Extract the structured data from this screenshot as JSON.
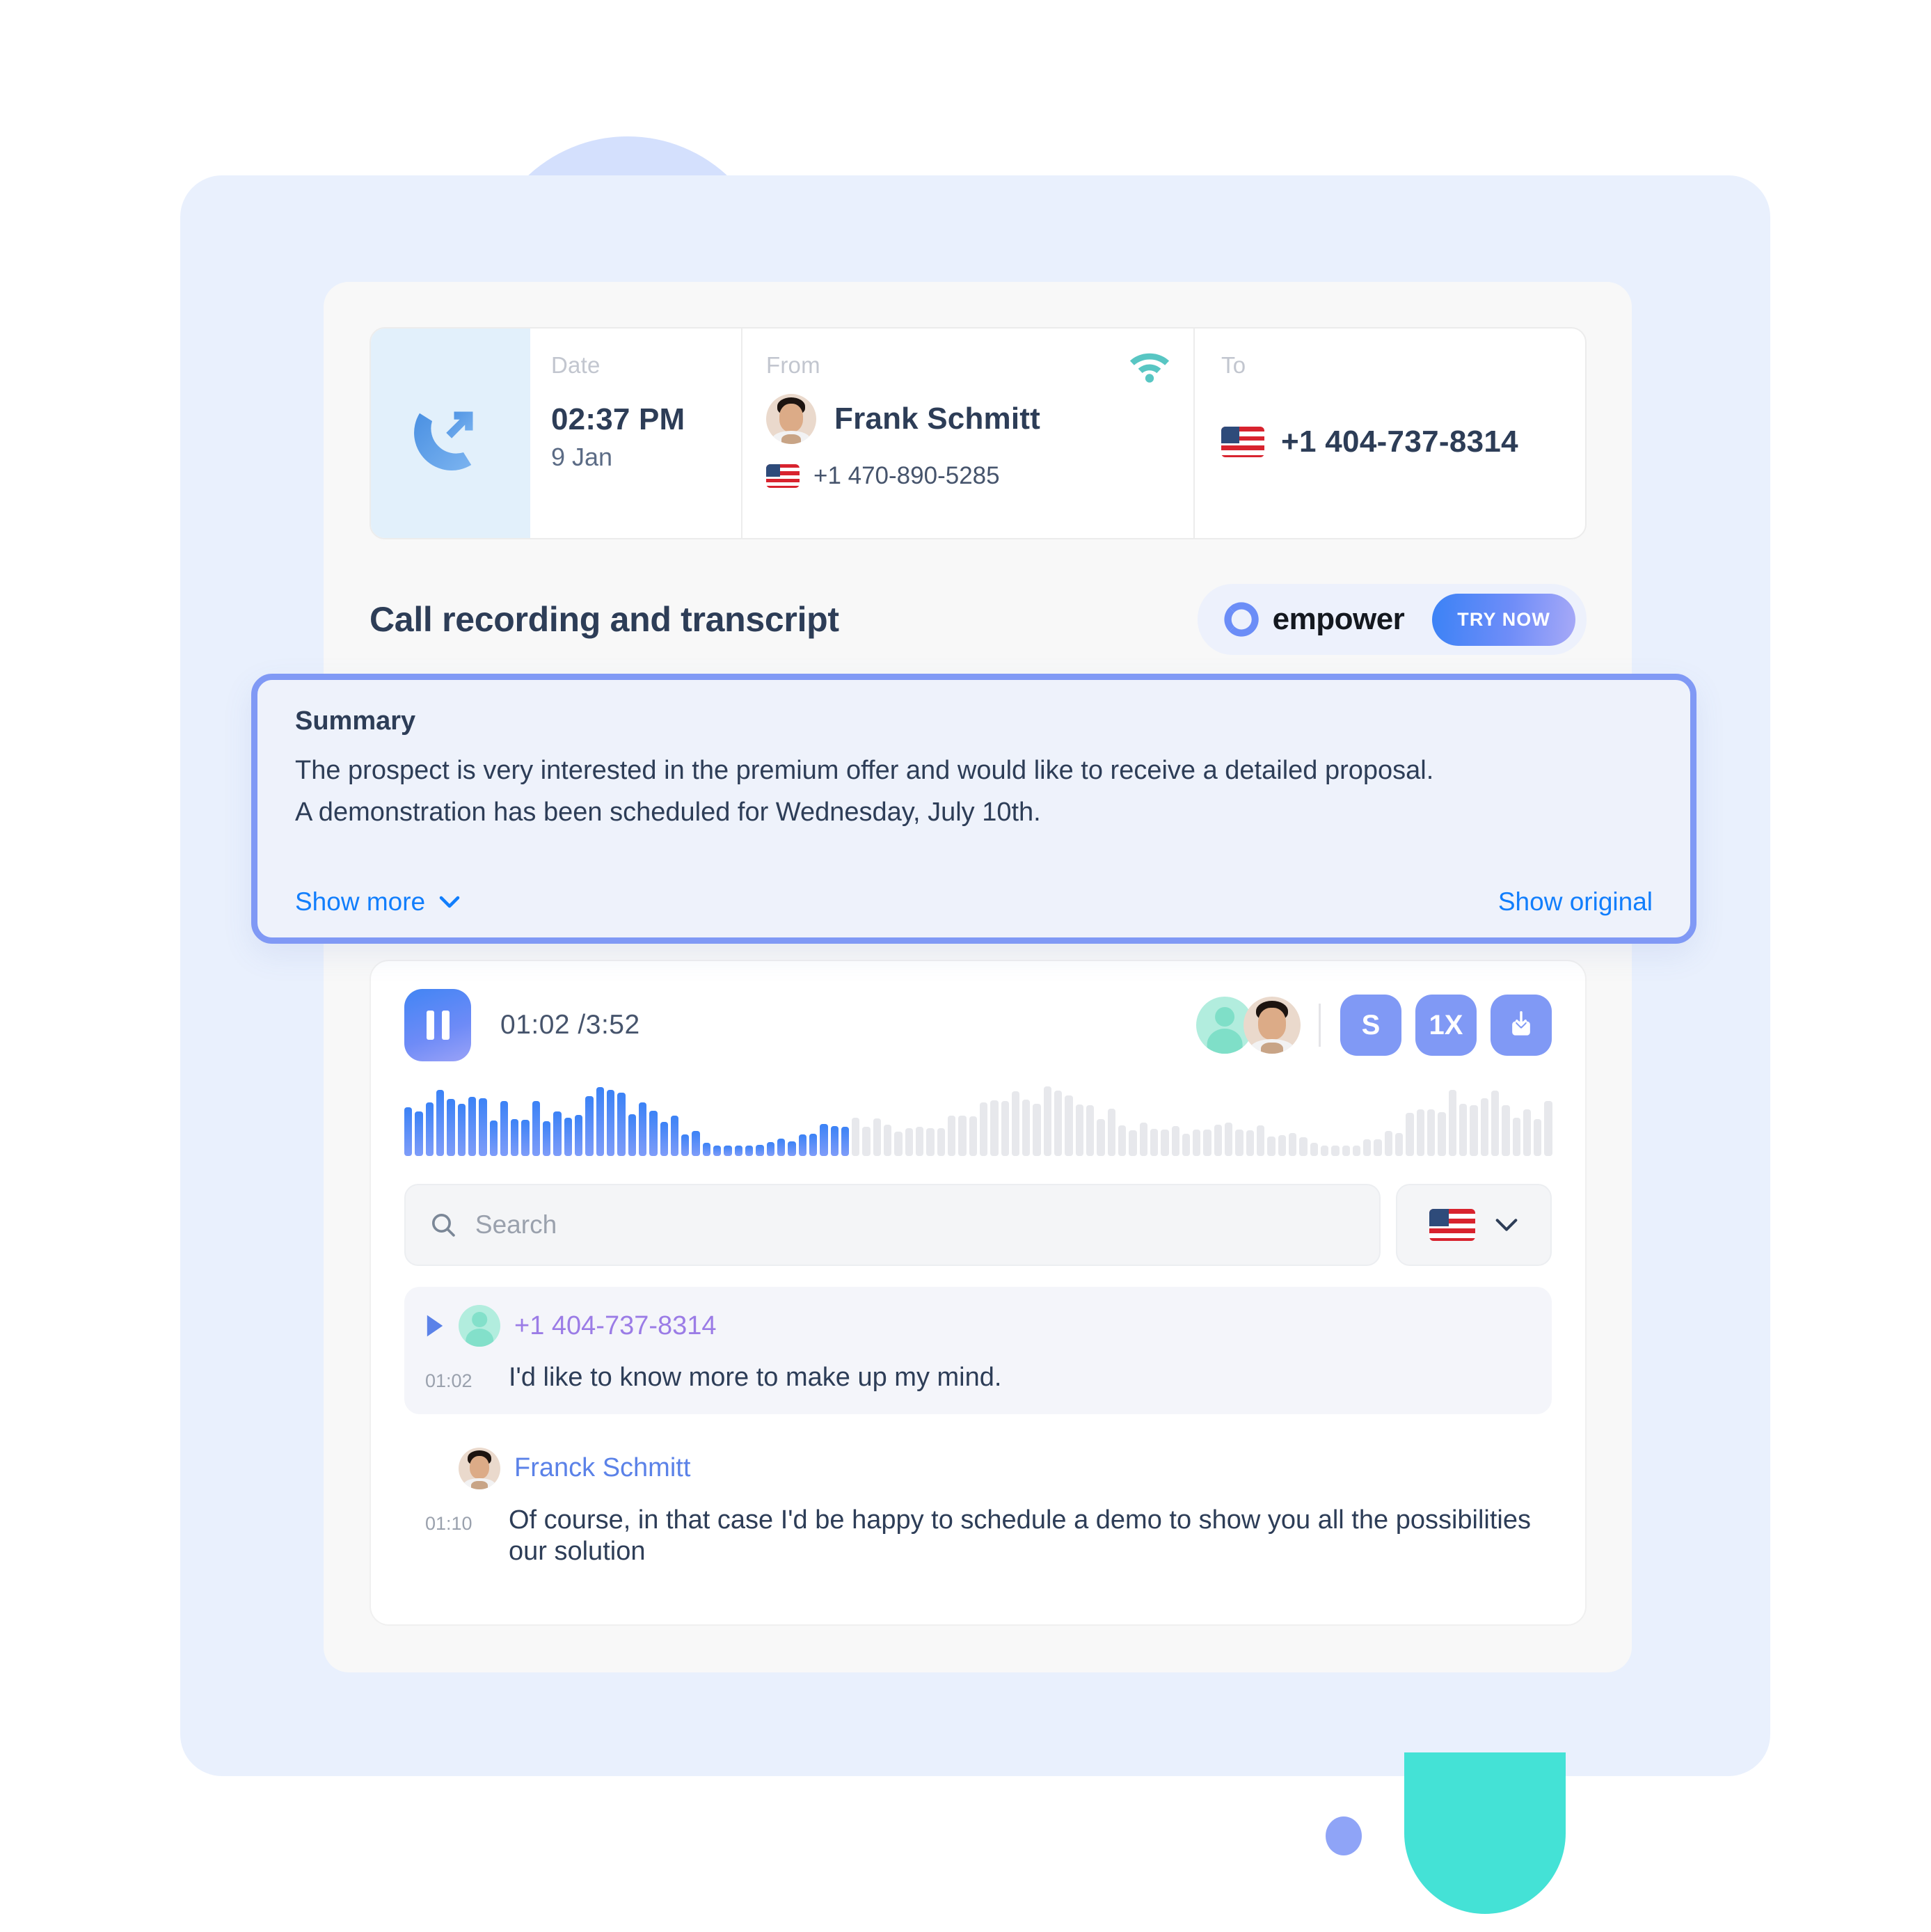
{
  "call_header": {
    "call_icon": "outgoing-call-icon",
    "date": {
      "label": "Date",
      "time": "02:37 PM",
      "day": "9 Jan"
    },
    "from": {
      "label": "From",
      "name": "Frank Schmitt",
      "phone": "+1 470-890-5285",
      "flag": "us-flag-icon",
      "signal_icon": "wifi-icon"
    },
    "to": {
      "label": "To",
      "phone": "+1 404-737-8314",
      "flag": "us-flag-icon"
    }
  },
  "section": {
    "title": "Call recording and transcript",
    "badge": {
      "logo": "empower-logo-icon",
      "name": "empower",
      "cta": "TRY NOW"
    }
  },
  "summary": {
    "heading": "Summary",
    "paragraph1": "The prospect is very interested in the premium offer and would like to receive a detailed proposal.",
    "paragraph2": "A demonstration has been scheduled for Wednesday, July 10th.",
    "show_more": "Show more",
    "show_original": "Show original"
  },
  "player": {
    "state": "playing",
    "current_time": "01:02",
    "total_time": "3:52",
    "timecode": "01:02 /3:52",
    "progress_percent": 27,
    "controls": {
      "subtitles_label": "S",
      "speed_label": "1X",
      "download_icon": "download-icon"
    },
    "speakers": [
      "generic-avatar",
      "frank-schmitt-avatar"
    ]
  },
  "search": {
    "placeholder": "Search",
    "value": "",
    "language_flag": "us-flag-icon",
    "chevron": "chevron-down-icon"
  },
  "transcript": [
    {
      "speaker": "+1 404-737-8314",
      "speaker_type": "phone",
      "avatar": "generic-avatar",
      "time": "01:02",
      "text": "I'd like to know more to make up my mind.",
      "active": true
    },
    {
      "speaker": "Franck Schmitt",
      "speaker_type": "person",
      "avatar": "frank-schmitt-avatar",
      "time": "01:10",
      "text": "Of course, in that case I'd be happy to schedule a demo to show you all the possibilities our solution",
      "active": false
    }
  ],
  "colors": {
    "accent_blue": "#3b82f6",
    "periwinkle": "#8099f5",
    "link_blue": "#117efc",
    "teal": "#44e2d6",
    "purple": "#9b7ce6",
    "frame_blue": "#e9f0fd",
    "text_dark": "#2d3d57"
  }
}
